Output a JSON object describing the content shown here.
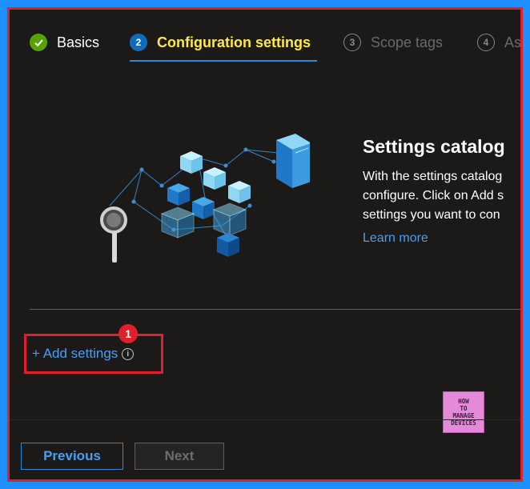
{
  "wizard": {
    "steps": [
      {
        "number": "",
        "label": "Basics",
        "state": "done",
        "icon": "check-icon"
      },
      {
        "number": "2",
        "label": "Configuration settings",
        "state": "active"
      },
      {
        "number": "3",
        "label": "Scope tags",
        "state": "inactive"
      },
      {
        "number": "4",
        "label": "As",
        "state": "inactive"
      }
    ]
  },
  "catalog": {
    "title": "Settings catalog",
    "desc_line1": "With the settings catalog",
    "desc_line2": "configure. Click on Add s",
    "desc_line3": "settings you want to con",
    "learn_more": "Learn more"
  },
  "actions": {
    "add_settings": "+ Add settings",
    "info_icon": "i",
    "badge": "1"
  },
  "logo": {
    "line1": "HOW",
    "line2": "TO",
    "line3": "MANAGE",
    "line4": "DEVICES"
  },
  "footer": {
    "previous": "Previous",
    "next": "Next"
  },
  "colors": {
    "accent": "#479ef5",
    "active_step": "#ffeb3b",
    "annotation": "#e0202a",
    "background": "#1b1a19"
  }
}
